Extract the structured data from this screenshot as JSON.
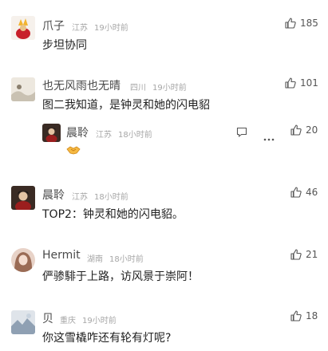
{
  "comments": [
    {
      "name": "爪子",
      "location": "江苏",
      "time": "19小时前",
      "text": "步坦协同",
      "likes": "185"
    },
    {
      "name": "也无风雨也无晴",
      "location": "四川",
      "time": "19小时前",
      "text": "图二我知道，是钟灵和她的闪电貂",
      "likes": "101",
      "reply": {
        "name": "晨聆",
        "location": "江苏",
        "time": "18小时前",
        "likes": "20",
        "reply_icon": "comment-icon",
        "more_icon": "more-icon",
        "emoji": "handshake-emoji"
      }
    },
    {
      "name": "晨聆",
      "location": "江苏",
      "time": "18小时前",
      "text": "TOP2：钟灵和她的闪电貂。",
      "likes": "46"
    },
    {
      "name": "Hermit",
      "location": "湖南",
      "time": "18小时前",
      "text": "俨骖騑于上路，访风景于崇阿！",
      "likes": "21"
    },
    {
      "name": "贝",
      "location": "重庆",
      "time": "19小时前",
      "text": "你这雪橇咋还有轮有灯呢?",
      "likes": "18"
    }
  ],
  "colors": {
    "name": "#4a4a4a",
    "meta": "#a6a6a6",
    "text": "#222222"
  }
}
